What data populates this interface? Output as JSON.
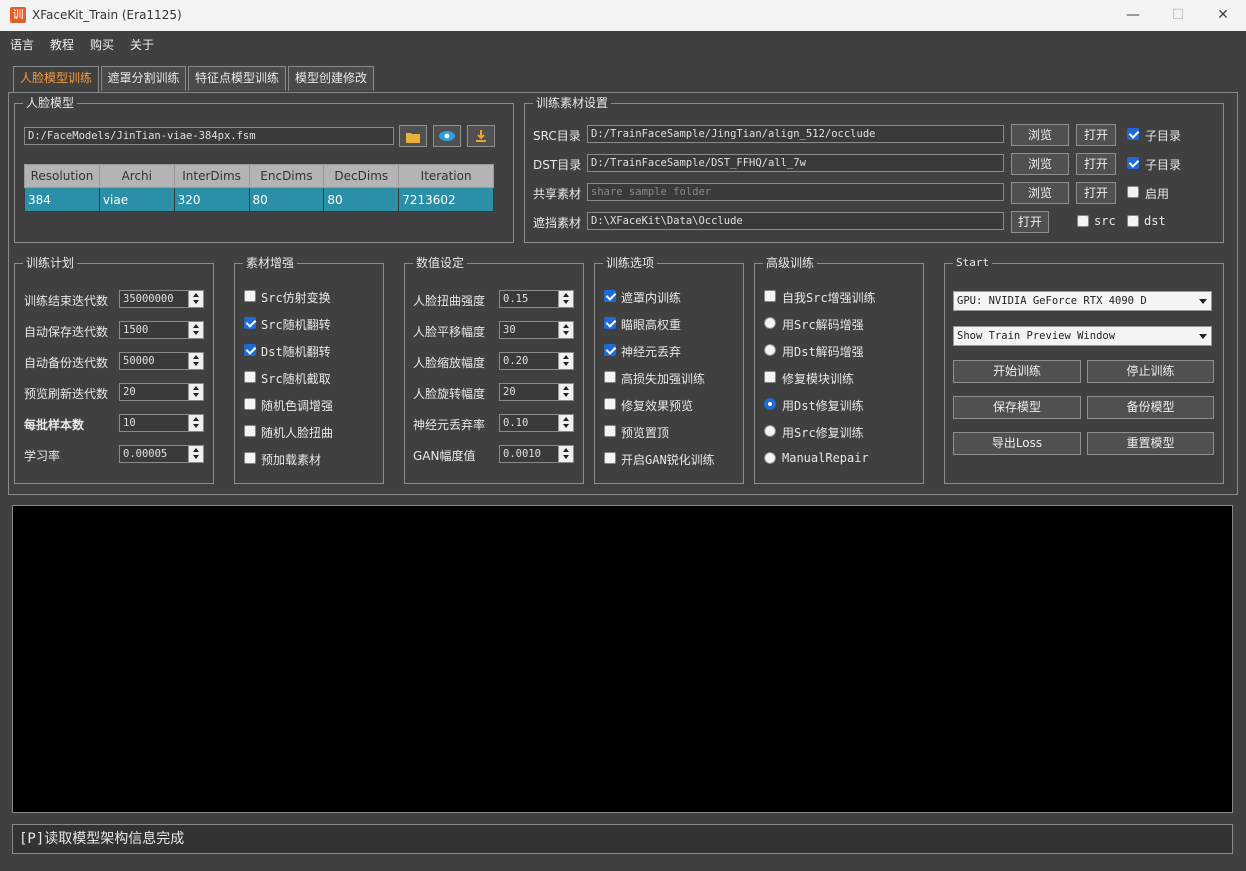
{
  "window": {
    "title": "XFaceKit_Train (Era1125)",
    "icon_char": "训",
    "min": "—",
    "max": "☐",
    "close": "✕"
  },
  "menu": [
    "语言",
    "教程",
    "购买",
    "关于"
  ],
  "tabs": [
    "人脸模型训练",
    "遮罩分割训练",
    "特征点模型训练",
    "模型创建修改"
  ],
  "face_model": {
    "title": "人脸模型",
    "path": "D:/FaceModels/JinTian-viae-384px.fsm",
    "table": {
      "headers": [
        "Resolution",
        "Archi",
        "InterDims",
        "EncDims",
        "DecDims",
        "Iteration"
      ],
      "row": [
        "384",
        "viae",
        "320",
        "80",
        "80",
        "7213602"
      ]
    }
  },
  "material": {
    "title": "训练素材设置",
    "src_label": "SRC目录",
    "src_path": "D:/TrainFaceSample/JingTian/align_512/occlude",
    "dst_label": "DST目录",
    "dst_path": "D:/TrainFaceSample/DST_FFHQ/all_7w",
    "shared_label": "共享素材",
    "shared_placeholder": "share sample folder",
    "mask_label": "遮挡素材",
    "mask_path": "D:\\XFaceKit\\Data\\Occlude",
    "browse": "浏览",
    "open": "打开",
    "subdir": "子目录",
    "enable": "启用",
    "src": "src",
    "dst": "dst"
  },
  "plan": {
    "title": "训练计划",
    "items": [
      {
        "label": "训练结束迭代数",
        "value": "35000000"
      },
      {
        "label": "自动保存迭代数",
        "value": "1500"
      },
      {
        "label": "自动备份迭代数",
        "value": "50000"
      },
      {
        "label": "预览刷新迭代数",
        "value": "20"
      },
      {
        "label": "每批样本数",
        "value": "10"
      },
      {
        "label": "学习率",
        "value": "0.00005"
      }
    ]
  },
  "augment": {
    "title": "素材增强",
    "items": [
      {
        "label": "Src仿射变换",
        "checked": false
      },
      {
        "label": "Src随机翻转",
        "checked": true
      },
      {
        "label": "Dst随机翻转",
        "checked": true
      },
      {
        "label": "Src随机截取",
        "checked": false
      },
      {
        "label": "随机色调增强",
        "checked": false
      },
      {
        "label": "随机人脸扭曲",
        "checked": false
      },
      {
        "label": "预加载素材",
        "checked": false
      }
    ]
  },
  "values": {
    "title": "数值设定",
    "items": [
      {
        "label": "人脸扭曲强度",
        "value": "0.15"
      },
      {
        "label": "人脸平移幅度",
        "value": "30"
      },
      {
        "label": "人脸缩放幅度",
        "value": "0.20"
      },
      {
        "label": "人脸旋转幅度",
        "value": "20"
      },
      {
        "label": "神经元丢弃率",
        "value": "0.10"
      },
      {
        "label": "GAN幅度值",
        "value": "0.0010"
      }
    ]
  },
  "options": {
    "title": "训练选项",
    "items": [
      {
        "label": "遮罩内训练",
        "checked": true
      },
      {
        "label": "瞄眼高权重",
        "checked": true
      },
      {
        "label": "神经元丢弃",
        "checked": true
      },
      {
        "label": "高损失加强训练",
        "checked": false
      },
      {
        "label": "修复效果预览",
        "checked": false
      },
      {
        "label": "预览置顶",
        "checked": false
      },
      {
        "label": "开启GAN锐化训练",
        "checked": false
      }
    ]
  },
  "advanced": {
    "title": "高级训练",
    "items": [
      {
        "label": "自我Src增强训练",
        "kind": "check",
        "checked": false
      },
      {
        "label": "用Src解码增强",
        "kind": "radio",
        "checked": false
      },
      {
        "label": "用Dst解码增强",
        "kind": "radio",
        "checked": false
      },
      {
        "label": "修复模块训练",
        "kind": "check",
        "checked": false
      },
      {
        "label": "用Dst修复训练",
        "kind": "radio",
        "checked": true
      },
      {
        "label": "用Src修复训练",
        "kind": "radio",
        "checked": false
      },
      {
        "label": "ManualRepair",
        "kind": "radio",
        "checked": false
      }
    ]
  },
  "start": {
    "title": "Start",
    "gpu": "GPU: NVIDIA GeForce RTX 4090 D",
    "preview_mode": "Show Train Preview Window",
    "buttons": [
      "开始训练",
      "停止训练",
      "保存模型",
      "备份模型",
      "导出Loss",
      "重置模型"
    ]
  },
  "status": "[P]读取模型架构信息完成"
}
